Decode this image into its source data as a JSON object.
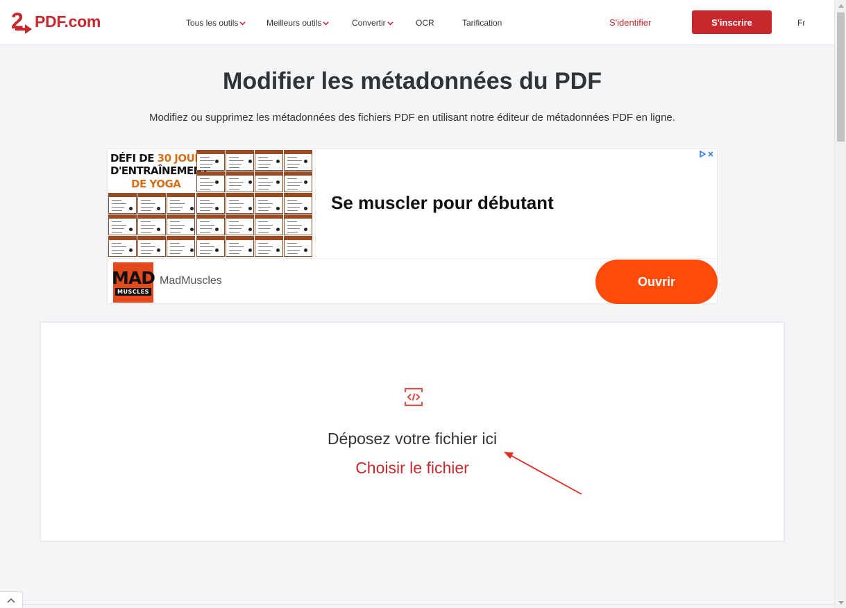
{
  "brand": {
    "logo_number": "2",
    "logo_text": "PDF.com",
    "color": "#c7282d"
  },
  "nav": {
    "items": [
      {
        "label": "Tous les outils",
        "has_dropdown": true
      },
      {
        "label": "Meilleurs outils",
        "has_dropdown": true
      },
      {
        "label": "Convertir",
        "has_dropdown": true
      },
      {
        "label": "OCR",
        "has_dropdown": false
      },
      {
        "label": "Tarification",
        "has_dropdown": false
      }
    ],
    "login": "S'identifier",
    "signup": "S'inscrire",
    "language": "Fr"
  },
  "main": {
    "title": "Modifier les métadonnées du PDF",
    "subtitle": "Modifiez ou supprimez les métadonnées des fichiers PDF en utilisant notre éditeur de métadonnées PDF en ligne."
  },
  "ad": {
    "image_title_line1_a": "DÉFI DE ",
    "image_title_line1_b": "30 JOURS",
    "image_title_line2": "D'ENTRAÎNEMENT",
    "image_title_line3": "DE YOGA",
    "headline": "Se muscler pour débutant",
    "brand_logo_top": "MAD",
    "brand_logo_bottom": "MUSCLES",
    "brand_name": "MadMuscles",
    "cta": "Ouvrir",
    "cta_color": "#ff4b0a",
    "choice_icon": "adchoices-icon",
    "close_icon": "close-icon"
  },
  "dropzone": {
    "icon": "code-file-icon",
    "text": "Déposez votre fichier ici",
    "choose": "Choisir le fichier"
  },
  "scroll_top_icon": "chevron-up-icon"
}
